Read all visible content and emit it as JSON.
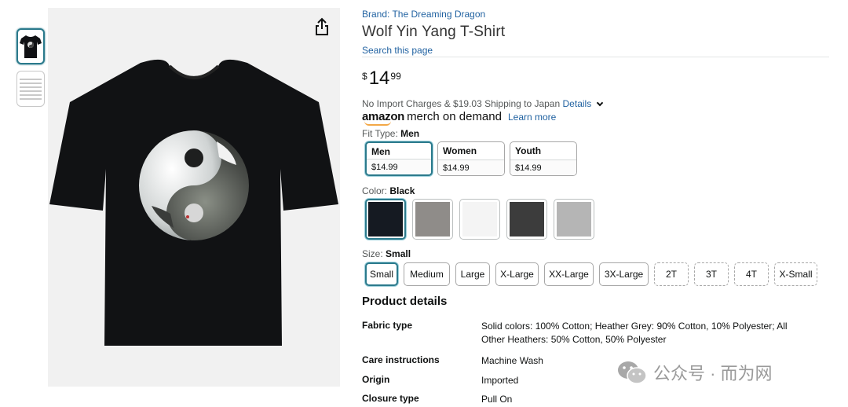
{
  "product": {
    "brand": "Brand: The Dreaming Dragon",
    "title": "Wolf Yin Yang T-Shirt",
    "search_link": "Search this page",
    "price": {
      "symbol": "$",
      "whole": "14",
      "fraction": "99"
    },
    "shipping": {
      "text": "No Import Charges & $19.03 Shipping to Japan",
      "details_label": "Details"
    },
    "merch": {
      "amazon": "amazon",
      "brand": "merch on demand",
      "learn_more": "Learn more"
    }
  },
  "fit_type": {
    "label": "Fit Type: ",
    "selected": "Men",
    "options": [
      {
        "name": "Men",
        "price": "$14.99"
      },
      {
        "name": "Women",
        "price": "$14.99"
      },
      {
        "name": "Youth",
        "price": "$14.99"
      }
    ]
  },
  "color": {
    "label": "Color: ",
    "selected": "Black",
    "swatches": [
      "#151a22",
      "#8f8c89",
      "#f4f4f4",
      "#3c3c3c",
      "#b5b5b5"
    ]
  },
  "size": {
    "label": "Size: ",
    "selected": "Small",
    "options": [
      "Small",
      "Medium",
      "Large",
      "X-Large",
      "XX-Large",
      "3X-Large",
      "2T",
      "3T",
      "4T",
      "X-Small"
    ]
  },
  "details": {
    "title": "Product details",
    "rows": [
      {
        "key": "Fabric type",
        "value": "Solid colors: 100% Cotton; Heather Grey: 90% Cotton, 10% Polyester; All Other Heathers: 50% Cotton, 50% Polyester"
      },
      {
        "key": "Care instructions",
        "value": "Machine Wash"
      },
      {
        "key": "Origin",
        "value": "Imported"
      },
      {
        "key": "Closure type",
        "value": "Pull On"
      }
    ]
  },
  "watermark": {
    "text": "公众号 · 而为网"
  },
  "icons": {
    "share": "share-icon",
    "wechat": "wechat-icon",
    "details_chevron": "chevron-down-icon"
  }
}
